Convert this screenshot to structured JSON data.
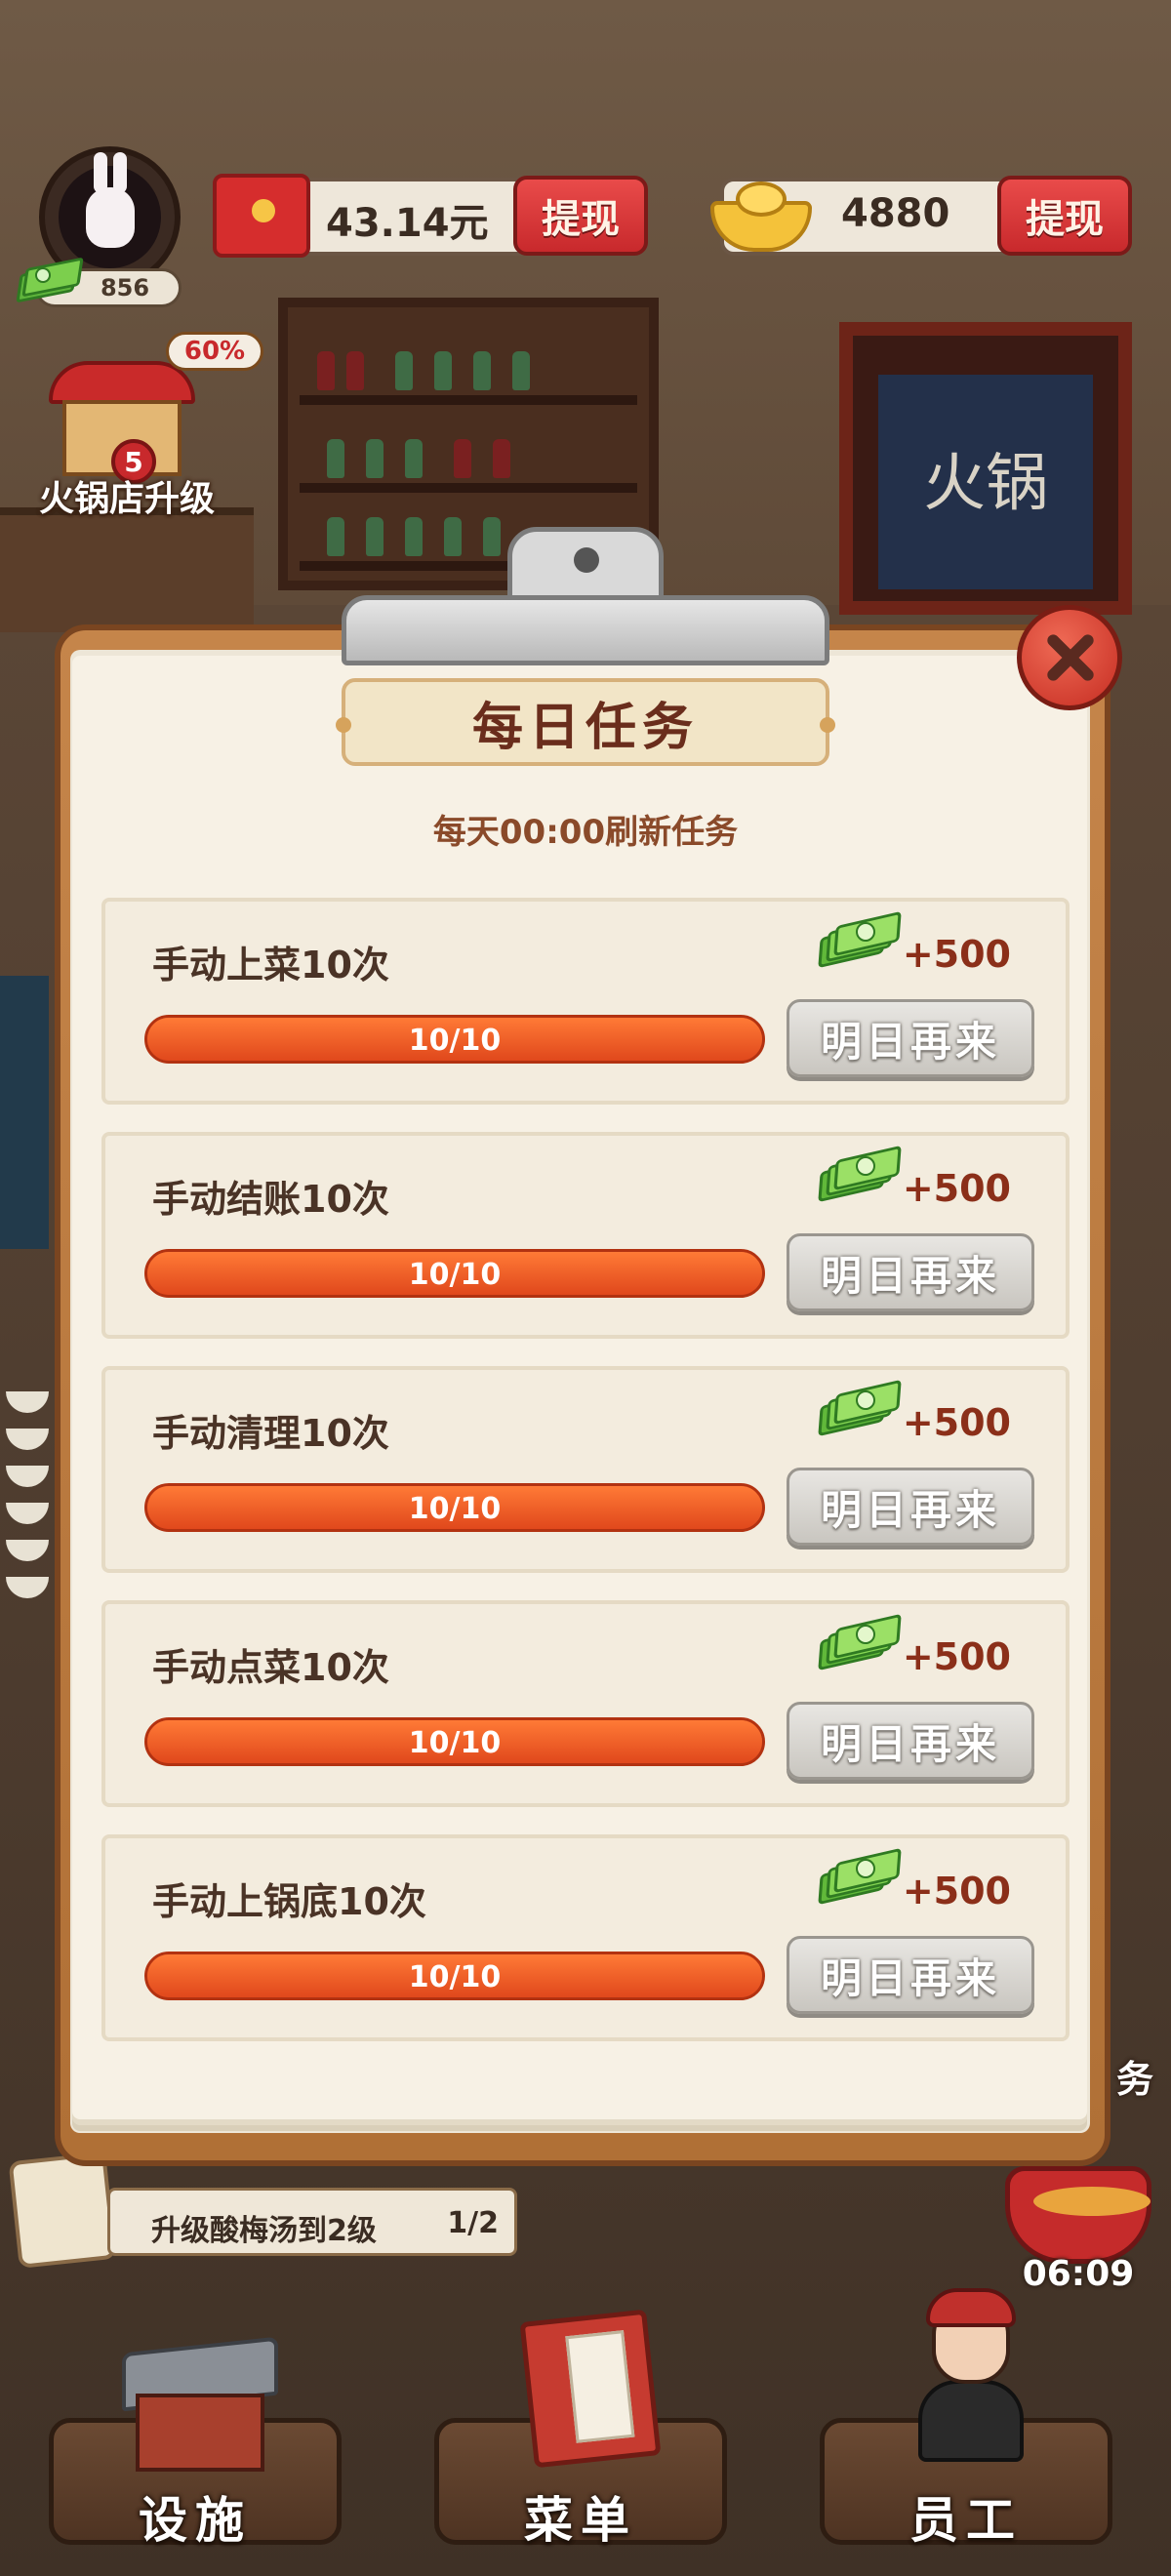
{
  "hud": {
    "avatar_cash": "856",
    "balance_yuan": "43.14元",
    "withdraw_label_1": "提现",
    "gold": "4880",
    "withdraw_label_2": "提现"
  },
  "upgrade": {
    "percent": "60%",
    "level": "5",
    "label": "火锅店升级"
  },
  "scene": {
    "curtain_text": "火锅"
  },
  "modal": {
    "title": "每日任务",
    "subtitle": "每天00:00刷新任务",
    "tasks": [
      {
        "name": "手动上菜10次",
        "reward": "+500",
        "progress": "10/10",
        "progress_fraction": 1.0,
        "button": "明日再来"
      },
      {
        "name": "手动结账10次",
        "reward": "+500",
        "progress": "10/10",
        "progress_fraction": 1.0,
        "button": "明日再来"
      },
      {
        "name": "手动清理10次",
        "reward": "+500",
        "progress": "10/10",
        "progress_fraction": 1.0,
        "button": "明日再来"
      },
      {
        "name": "手动点菜10次",
        "reward": "+500",
        "progress": "10/10",
        "progress_fraction": 1.0,
        "button": "明日再来"
      },
      {
        "name": "手动上锅底10次",
        "reward": "+500",
        "progress": "10/10",
        "progress_fraction": 1.0,
        "button": "明日再来"
      }
    ]
  },
  "quest": {
    "text": "升级酸梅汤到2级",
    "count": "1/2"
  },
  "side": {
    "task_label": "务",
    "timer": "06:09"
  },
  "nav": {
    "facility": "设施",
    "menu": "菜单",
    "staff": "员工"
  },
  "colors": {
    "accent_red": "#c8292c",
    "progress_orange": "#e0481c",
    "cash_green": "#61b93a",
    "title_brown": "#6a2d1c"
  },
  "icons": [
    "rabbit-avatar-icon",
    "cash-icon",
    "red-envelope-icon",
    "gold-ingot-icon",
    "restaurant-upgrade-icon",
    "close-icon",
    "scroll-icon",
    "hotpot-icon",
    "facility-icon",
    "menu-book-icon",
    "staff-icon"
  ]
}
